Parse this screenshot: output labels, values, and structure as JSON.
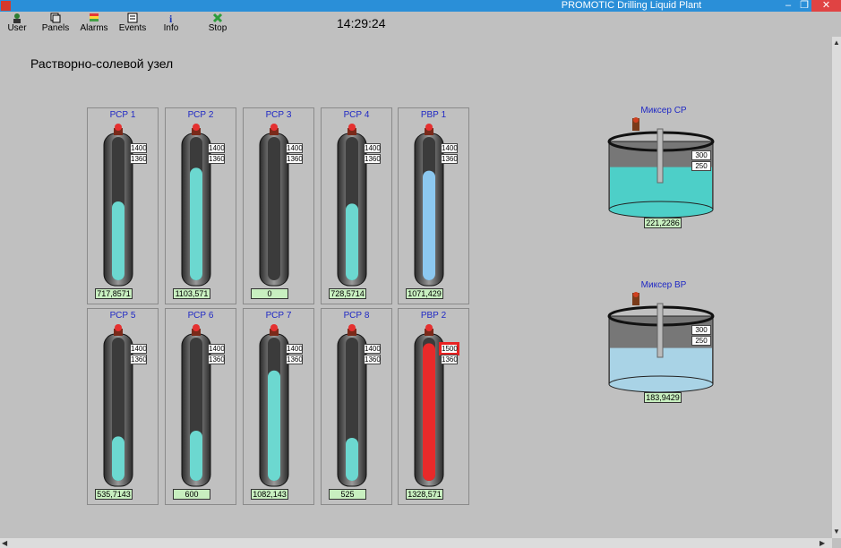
{
  "window": {
    "title": "PROMOTIC Drilling Liquid Plant",
    "btn_min": "–",
    "btn_max": "❐",
    "btn_close": "✕"
  },
  "toolbar": {
    "user": "User",
    "panels": "Panels",
    "alarms": "Alarms",
    "events": "Events",
    "info": "Info",
    "stop": "Stop"
  },
  "clock": "14:29:24",
  "heading": "Растворно-солевой узел",
  "colors": {
    "cyan": "#6cd8d0",
    "blue": "#8cc8f0",
    "red": "#e82a2a",
    "teal": "#4dcfc8"
  },
  "tanks": [
    {
      "name": "РСР 1",
      "hi": "1400",
      "lo": "1360",
      "value": "717,8571",
      "level": 0.55,
      "color": "#6cd8d0",
      "alarm": false
    },
    {
      "name": "РСР 2",
      "hi": "1400",
      "lo": "1360",
      "value": "1103,571",
      "level": 0.785,
      "color": "#6cd8d0",
      "alarm": false
    },
    {
      "name": "РСР 3",
      "hi": "1400",
      "lo": "1360",
      "value": "0",
      "level": 0.0,
      "color": "#6cd8d0",
      "alarm": false
    },
    {
      "name": "РСР 4",
      "hi": "1400",
      "lo": "1360",
      "value": "728,5714",
      "level": 0.535,
      "color": "#6cd8d0",
      "alarm": false
    },
    {
      "name": "РВР 1",
      "hi": "1400",
      "lo": "1360",
      "value": "1071,429",
      "level": 0.765,
      "color": "#8cc8f0",
      "alarm": false
    },
    {
      "name": "РСР 5",
      "hi": "1400",
      "lo": "1360",
      "value": "535,7143",
      "level": 0.31,
      "color": "#6cd8d0",
      "alarm": false
    },
    {
      "name": "РСР 6",
      "hi": "1400",
      "lo": "1360",
      "value": "600",
      "level": 0.35,
      "color": "#6cd8d0",
      "alarm": false
    },
    {
      "name": "РСР 7",
      "hi": "1400",
      "lo": "1360",
      "value": "1082,143",
      "level": 0.77,
      "color": "#6cd8d0",
      "alarm": false
    },
    {
      "name": "РСР 8",
      "hi": "1400",
      "lo": "1360",
      "value": "525",
      "level": 0.3,
      "color": "#6cd8d0",
      "alarm": false
    },
    {
      "name": "РВР 2",
      "hi": "1500",
      "lo": "1360",
      "value": "1328,571",
      "level": 0.96,
      "color": "#e82a2a",
      "alarm": true
    }
  ],
  "mixers": [
    {
      "name": "Миксер СР",
      "hi": "300",
      "lo": "250",
      "value": "221,2286",
      "level": 0.62,
      "color": "#4dcfc8"
    },
    {
      "name": "Миксер ВР",
      "hi": "300",
      "lo": "250",
      "value": "183,9429",
      "level": 0.52,
      "color": "#a9d3e6"
    }
  ]
}
